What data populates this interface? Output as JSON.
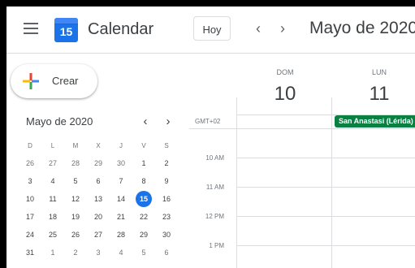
{
  "app": {
    "title": "Calendar",
    "logo_day": "15"
  },
  "header": {
    "today_label": "Hoy",
    "prev": "‹",
    "next": "›",
    "current_range": "Mayo de 2020"
  },
  "sidebar": {
    "create_label": "Crear",
    "mini_calendar": {
      "title": "Mayo de 2020",
      "prev": "‹",
      "next": "›",
      "weekday_headers": [
        "D",
        "L",
        "M",
        "X",
        "J",
        "V",
        "S"
      ],
      "weeks": [
        [
          "26",
          "27",
          "28",
          "29",
          "30",
          "1",
          "2"
        ],
        [
          "3",
          "4",
          "5",
          "6",
          "7",
          "8",
          "9"
        ],
        [
          "10",
          "11",
          "12",
          "13",
          "14",
          "15",
          "16"
        ],
        [
          "17",
          "18",
          "19",
          "20",
          "21",
          "22",
          "23"
        ],
        [
          "24",
          "25",
          "26",
          "27",
          "28",
          "29",
          "30"
        ],
        [
          "31",
          "1",
          "2",
          "3",
          "4",
          "5",
          "6"
        ]
      ],
      "today": "15"
    }
  },
  "days": [
    {
      "weekday": "DOM",
      "date": "10"
    },
    {
      "weekday": "LUN",
      "date": "11"
    }
  ],
  "timezone": "GMT+02",
  "times": [
    "10 AM",
    "11 AM",
    "12 PM",
    "1 PM"
  ],
  "events": [
    {
      "title": "San Anastasi (Lérida)",
      "color": "#0b8043"
    }
  ],
  "colors": {
    "accent": "#1a73e8",
    "event": "#0b8043"
  }
}
